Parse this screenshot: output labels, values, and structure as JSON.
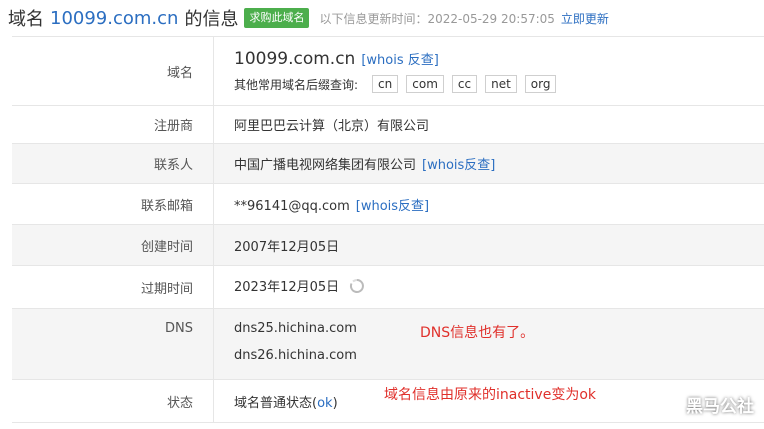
{
  "header": {
    "prefix": "域名",
    "domain": "10099.com.cn",
    "suffix": "的信息",
    "buy_button": "求购此域名",
    "update_text": "以下信息更新时间：2022-05-29 20:57:05",
    "update_link": "立即更新"
  },
  "rows": {
    "domain": {
      "label": "域名",
      "value": "10099.com.cn",
      "whois_link": "[whois 反查]",
      "suffix_label": "其他常用域名后缀查询:",
      "suffixes": [
        "cn",
        "com",
        "cc",
        "net",
        "org"
      ]
    },
    "registrar": {
      "label": "注册商",
      "value": "阿里巴巴云计算（北京）有限公司"
    },
    "contact": {
      "label": "联系人",
      "value": "中国广播电视网络集团有限公司",
      "link": "[whois反查]"
    },
    "email": {
      "label": "联系邮箱",
      "value": "**96141@qq.com",
      "link": "[whois反查]"
    },
    "created": {
      "label": "创建时间",
      "value": "2007年12月05日"
    },
    "expires": {
      "label": "过期时间",
      "value": "2023年12月05日"
    },
    "dns": {
      "label": "DNS",
      "values": [
        "dns25.hichina.com",
        "dns26.hichina.com"
      ]
    },
    "status": {
      "label": "状态",
      "value": "域名普通状态(",
      "ok": "ok",
      "close": ")"
    }
  },
  "annotations": {
    "dns_note": "DNS信息也有了。",
    "status_note": "域名信息由原来的inactive变为ok"
  },
  "watermark": "黑马公社",
  "colors": {
    "link": "#2b6ec1",
    "accent_green": "#4cae4c",
    "annotation": "#e0302b"
  }
}
